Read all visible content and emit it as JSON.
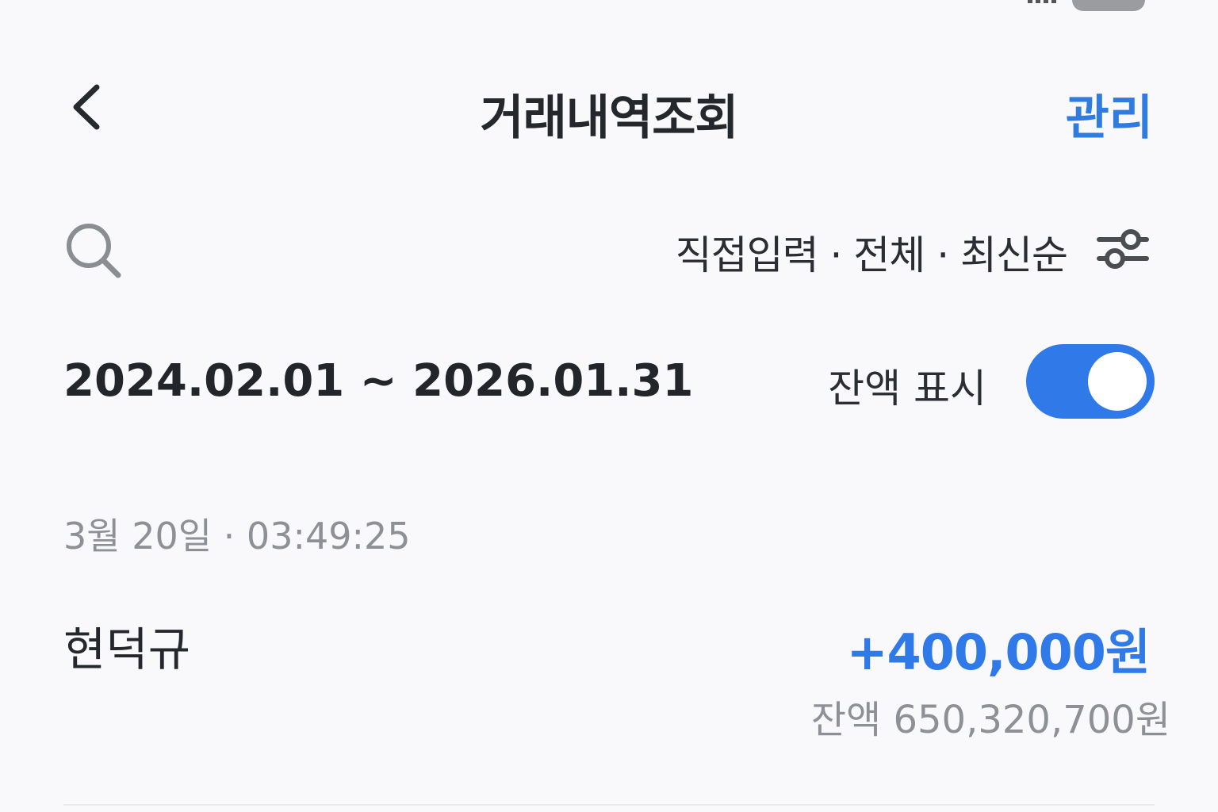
{
  "header": {
    "title": "거래내역조회",
    "manage_label": "관리"
  },
  "filter": {
    "summary": "직접입력 · 전체 · 최신순"
  },
  "range": {
    "dates": "2024.02.01 ~ 2026.01.31",
    "balance_toggle_label": "잔액 표시",
    "balance_toggle_on": true
  },
  "transactions": [
    {
      "datetime": "3월 20일 · 03:49:25",
      "name": "현덕규",
      "amount": "+400,000원",
      "balance": "잔액 650,320,700원"
    }
  ],
  "colors": {
    "accent": "#2f7ae8",
    "text": "#24272b",
    "muted": "#8d9095",
    "background": "#f9f9fb"
  },
  "icons": {
    "back": "chevron-left-icon",
    "search": "search-icon",
    "filter": "sliders-icon"
  }
}
